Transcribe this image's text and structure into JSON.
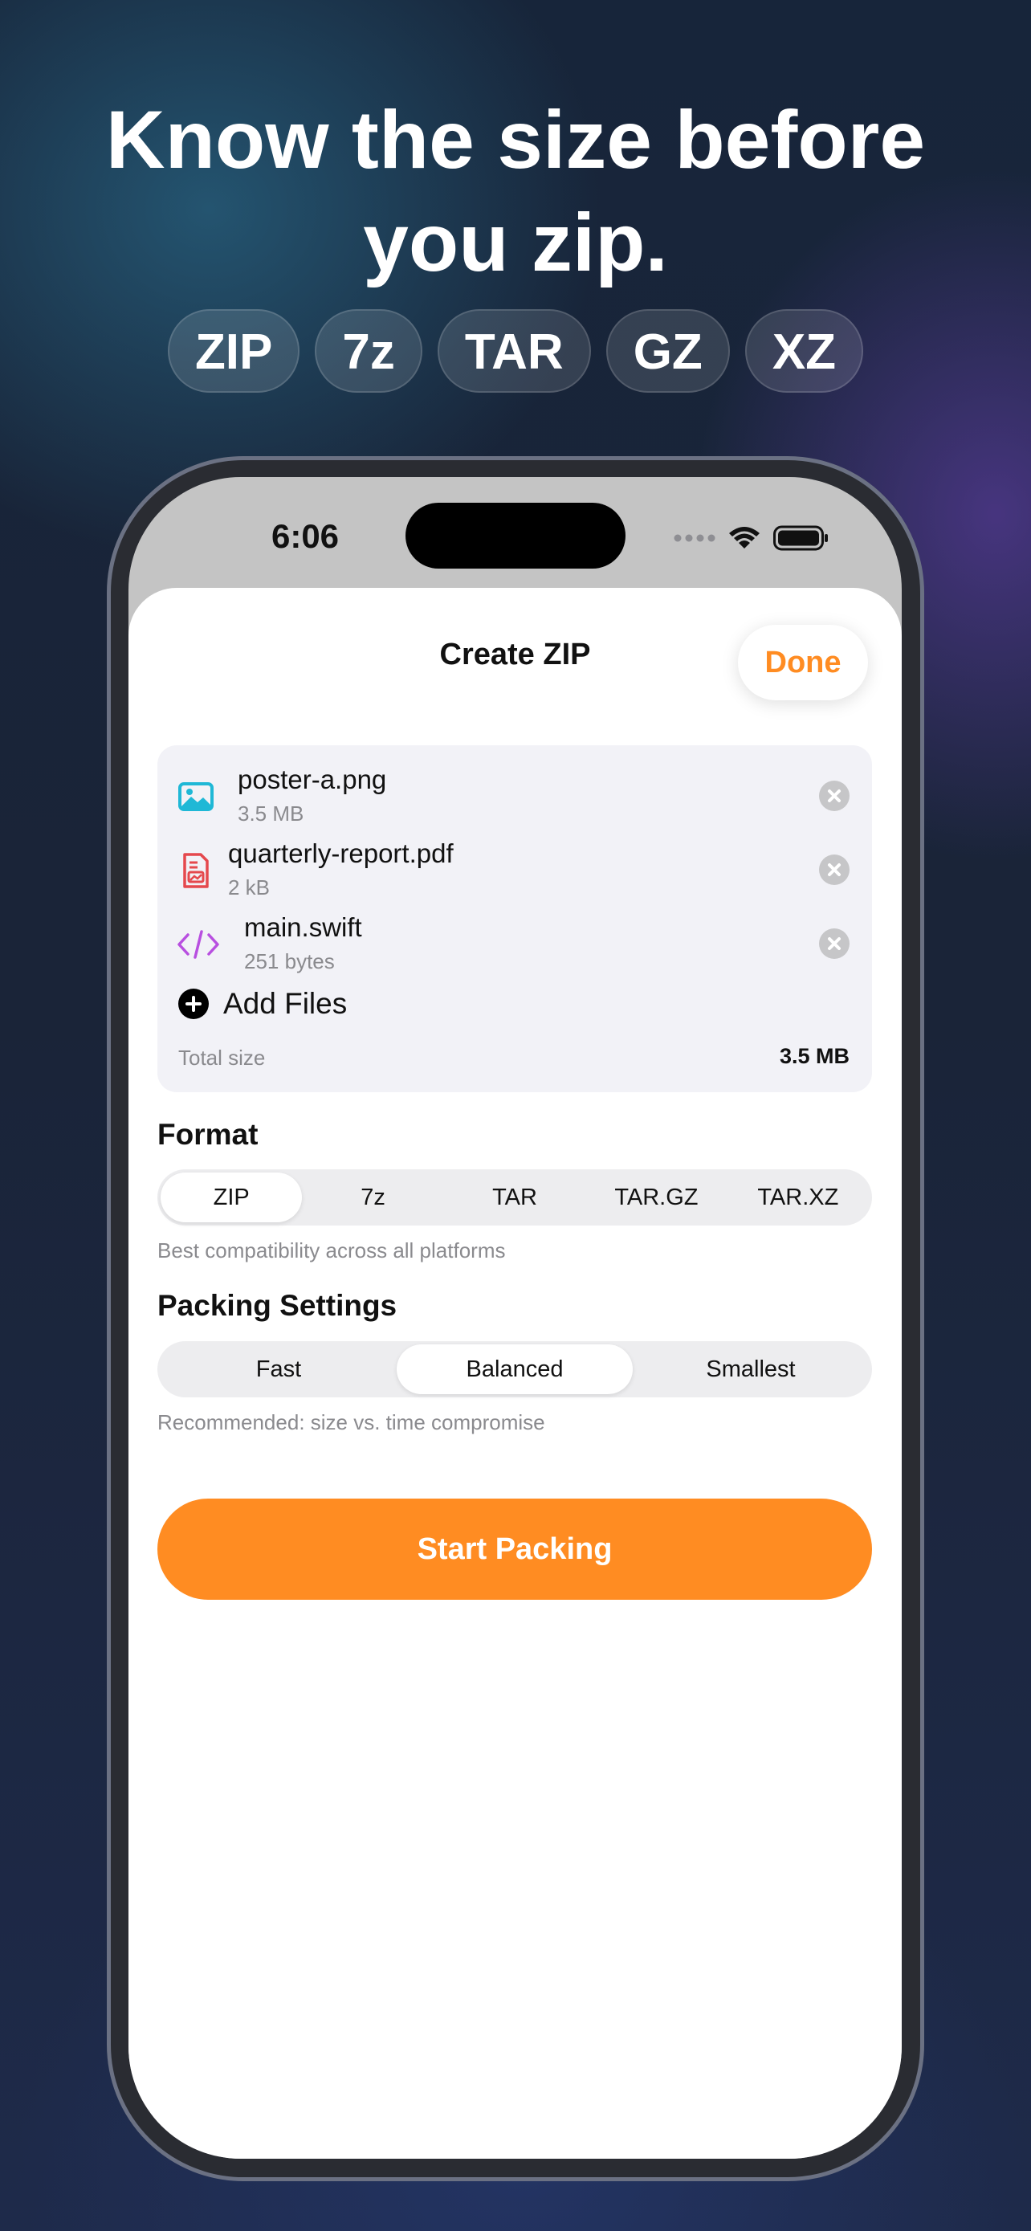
{
  "promo": {
    "headline_line1": "Know the size before",
    "headline_line2": "you zip.",
    "formats": [
      "ZIP",
      "7z",
      "TAR",
      "GZ",
      "XZ"
    ]
  },
  "status_bar": {
    "time": "6:06",
    "icons": [
      "dots-icon",
      "wifi-icon",
      "battery-icon"
    ]
  },
  "sheet": {
    "title": "Create ZIP",
    "done_label": "Done"
  },
  "files": {
    "items": [
      {
        "name": "poster-a.png",
        "size": "3.5 MB",
        "icon": "image-icon",
        "icon_color": "#1fb8d6"
      },
      {
        "name": "quarterly-report.pdf",
        "size": "2 kB",
        "icon": "pdf-icon",
        "icon_color": "#e5484d"
      },
      {
        "name": "main.swift",
        "size": "251 bytes",
        "icon": "code-icon",
        "icon_color": "#b84fe0"
      }
    ],
    "add_label": "Add Files",
    "total_label": "Total size",
    "total_value": "3.5 MB"
  },
  "format": {
    "heading": "Format",
    "options": [
      "ZIP",
      "7z",
      "TAR",
      "TAR.GZ",
      "TAR.XZ"
    ],
    "selected": "ZIP",
    "caption": "Best compatibility across all platforms"
  },
  "packing": {
    "heading": "Packing Settings",
    "options": [
      "Fast",
      "Balanced",
      "Smallest"
    ],
    "selected": "Balanced",
    "caption": "Recommended: size vs. time compromise"
  },
  "start_label": "Start Packing",
  "colors": {
    "accent": "#ff8c22",
    "card_bg": "#f2f2f7"
  }
}
